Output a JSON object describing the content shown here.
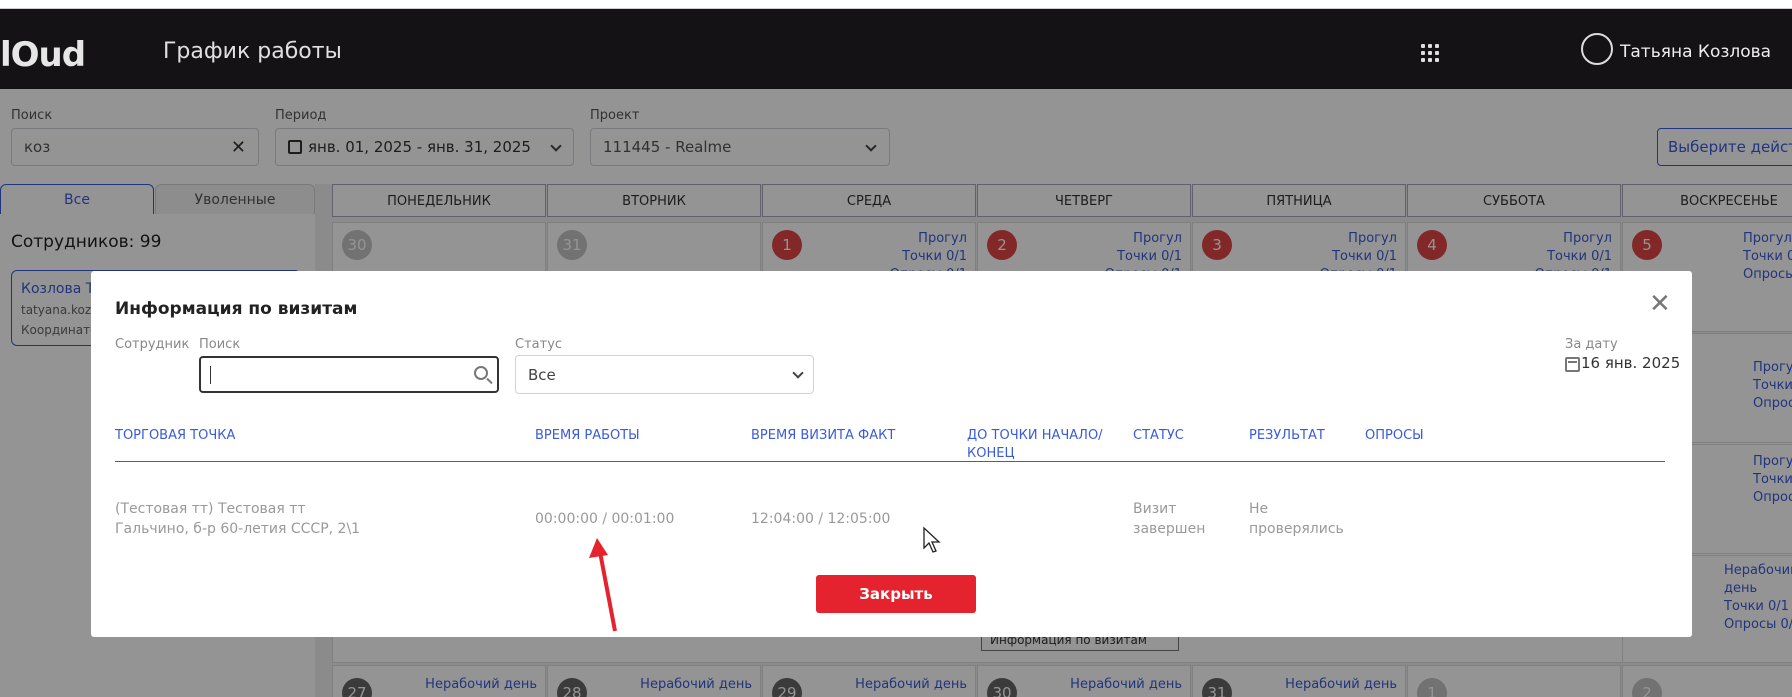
{
  "app": {
    "logo": "lOud",
    "title": "График работы",
    "user_name": "Татьяна Козлова"
  },
  "filters": {
    "search_label": "Поиск",
    "search_value": "коз",
    "period_label": "Период",
    "period_value": "янв. 01, 2025 - янв. 31, 2025",
    "project_label": "Проект",
    "project_value": "111445 - Realme",
    "actions_label": "Выберите действие"
  },
  "sidebar": {
    "tab_all": "Все",
    "tab_fired": "Уволенные",
    "count": "Сотрудников: 99",
    "employee": {
      "name": "Козлова Татьяна",
      "email": "tatyana.kozlova",
      "role": "Координатор"
    }
  },
  "calendar": {
    "days": [
      "ПОНЕДЕЛЬНИК",
      "ВТОРНИК",
      "СРЕДА",
      "ЧЕТВЕРГ",
      "ПЯТНИЦА",
      "СУББОТА",
      "ВОСКРЕСЕНЬЕ"
    ],
    "first_row": [
      "30",
      "31",
      "1",
      "2",
      "3",
      "4",
      "5"
    ],
    "last_row": [
      "27",
      "28",
      "29",
      "30",
      "31",
      "1",
      "2"
    ],
    "absence": "Прогул",
    "points": "Точки 0/1",
    "surveys": "Опросы 0/1",
    "nonwork": "Нерабочий день",
    "visits_link": "Информация по визитам"
  },
  "modal": {
    "title": "Информация по визитам",
    "employee_label": "Сотрудник",
    "search_label": "Поиск",
    "search_placeholder": "",
    "status_label": "Статус",
    "status_value": "Все",
    "date_label": "За дату",
    "date_value": "16 янв. 2025",
    "columns": [
      "ТОРГОВАЯ ТОЧКА",
      "ВРЕМЯ РАБОТЫ",
      "ВРЕМЯ ВИЗИТА ФАКТ",
      "ДО ТОЧКИ НАЧАЛО/ КОНЕЦ",
      "СТАТУС",
      "РЕЗУЛЬТАТ",
      "ОПРОСЫ"
    ],
    "row": {
      "point_line1": "(Тестовая тт) Тестовая тт",
      "point_line2": "Гальчино, б-р 60-летия СССР, 2\\1",
      "work_time": "00:00:00 / 00:01:00",
      "visit_time": "12:04:00 / 12:05:00",
      "status": "Визит завершен",
      "result": "Не проверялись"
    },
    "close_button": "Закрыть"
  },
  "colors": {
    "accent": "#3a5bd9",
    "danger": "#e5232f",
    "header": "#141214"
  }
}
